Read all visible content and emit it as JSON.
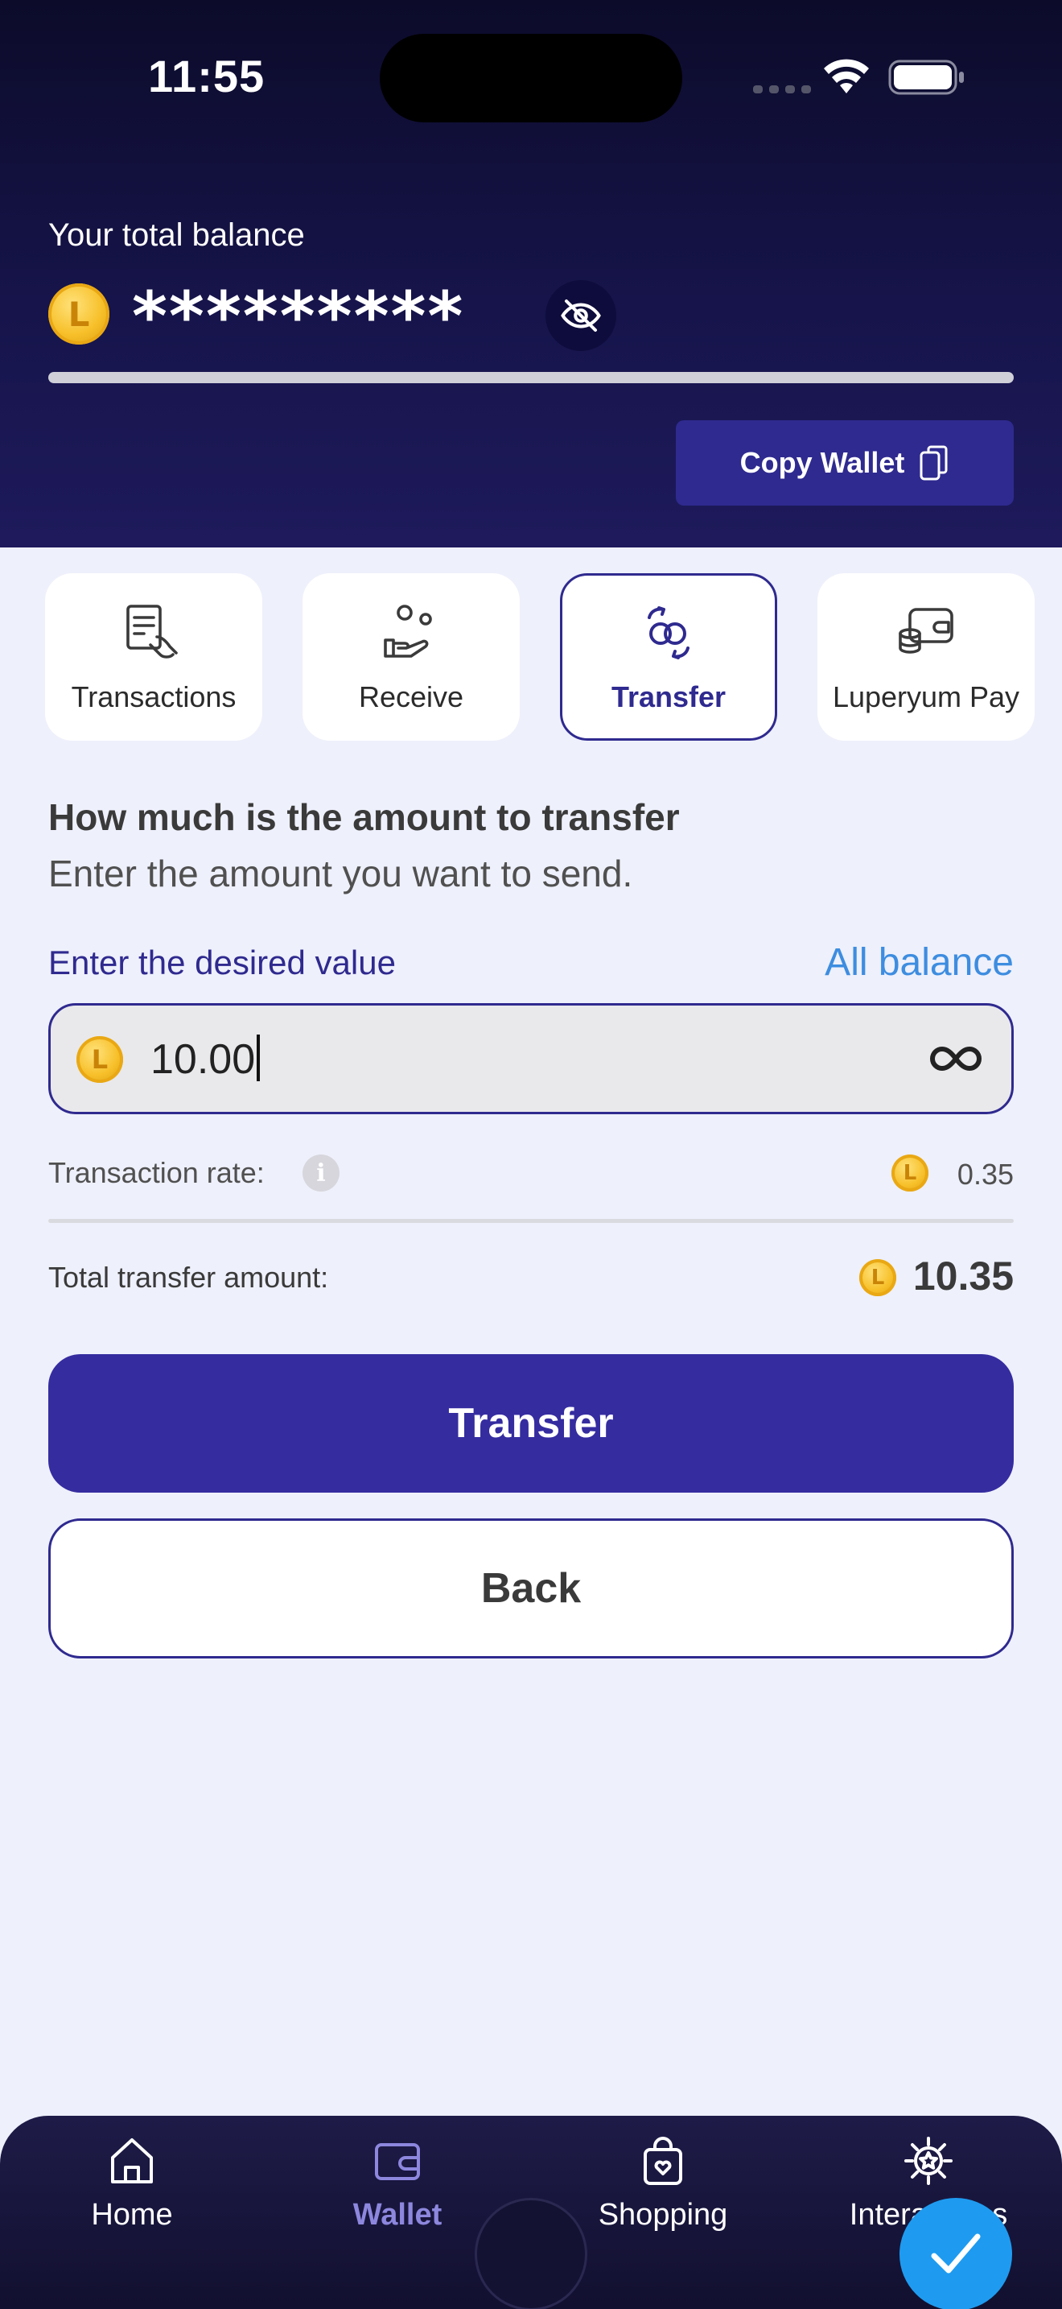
{
  "status_bar": {
    "time": "11:55"
  },
  "header": {
    "balance_label": "Your total balance",
    "balance_masked": "*********",
    "coin_symbol": "L",
    "copy_wallet_label": "Copy Wallet"
  },
  "tabs": [
    {
      "label": "Transactions",
      "icon": "transactions-icon",
      "active": false
    },
    {
      "label": "Receive",
      "icon": "receive-icon",
      "active": false
    },
    {
      "label": "Transfer",
      "icon": "transfer-icon",
      "active": true
    },
    {
      "label": "Luperyum Pay",
      "icon": "wallet-pay-icon",
      "active": false
    }
  ],
  "transfer": {
    "title": "How much is the amount to transfer",
    "subtitle": "Enter the amount you want to send.",
    "field_label": "Enter the desired value",
    "all_balance_label": "All balance",
    "amount_value": "10.00",
    "rate_label": "Transaction rate:",
    "rate_value": "0.35",
    "total_label": "Total transfer amount:",
    "total_value": "10.35",
    "transfer_button": "Transfer",
    "back_button": "Back"
  },
  "bottom_nav": [
    {
      "label": "Home",
      "icon": "home-icon",
      "active": false
    },
    {
      "label": "Wallet",
      "icon": "wallet-icon",
      "active": true
    },
    {
      "label": "Shopping",
      "icon": "shopping-bag-icon",
      "active": false
    },
    {
      "label": "Interactions",
      "icon": "interactions-icon",
      "active": false
    }
  ],
  "colors": {
    "primary": "#352ca0",
    "header_dark": "#0c0b2a",
    "accent_link": "#3d8de0",
    "coin_gold": "#f7c02a",
    "fab_blue": "#1e9bf0"
  }
}
